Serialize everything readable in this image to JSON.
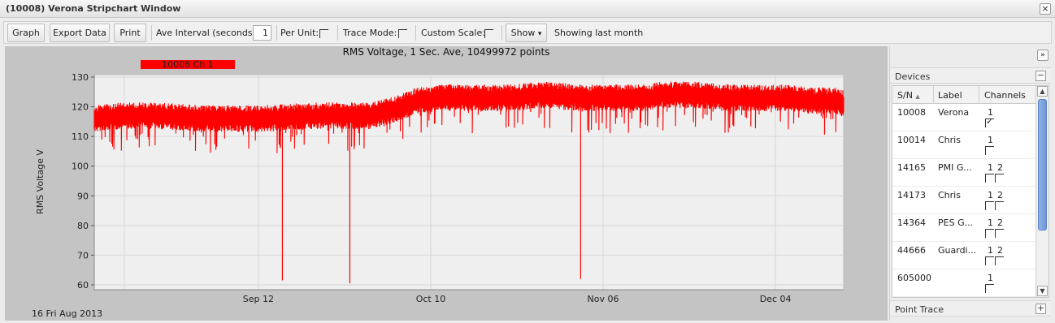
{
  "window": {
    "title": "(10008) Verona Stripchart Window",
    "close_glyph": "×"
  },
  "toolbar": {
    "graph": "Graph",
    "export": "Export Data",
    "print": "Print",
    "ave_label": "Ave Interval (seconds)",
    "ave_value": "1",
    "per_unit": "Per Unit:",
    "trace_mode": "Trace Mode:",
    "custom_scale": "Custom Scale:",
    "show": "Show",
    "show_arrow": "▾",
    "status": "Showing last month"
  },
  "chart": {
    "title": "RMS Voltage, 1 Sec. Ave, 10499972 points",
    "legend": "10008 Ch 1",
    "date_label": "16 Fri Aug 2013",
    "series_color": "#ff0000"
  },
  "chart_data": {
    "type": "line",
    "title": "RMS Voltage, 1 Sec. Ave, 10499972 points",
    "ylabel": "RMS Voltage V",
    "xlabel": "",
    "ylim": [
      60,
      130
    ],
    "yticks": [
      130,
      120,
      110,
      100,
      90,
      80,
      70,
      60
    ],
    "xticks": [
      "Sep 12",
      "Oct 10",
      "Nov 06",
      "Dec 04"
    ],
    "series": [
      {
        "name": "10008 Ch 1",
        "baseline": [
          [
            0.0,
            116
          ],
          [
            0.04,
            117
          ],
          [
            0.08,
            117
          ],
          [
            0.15,
            116
          ],
          [
            0.22,
            116
          ],
          [
            0.3,
            117
          ],
          [
            0.37,
            117
          ],
          [
            0.4,
            119
          ],
          [
            0.43,
            122
          ],
          [
            0.46,
            123
          ],
          [
            0.5,
            123
          ],
          [
            0.55,
            123
          ],
          [
            0.6,
            124
          ],
          [
            0.65,
            123
          ],
          [
            0.7,
            123
          ],
          [
            0.74,
            123
          ],
          [
            0.75,
            124
          ],
          [
            0.8,
            124
          ],
          [
            0.85,
            123
          ],
          [
            0.9,
            123
          ],
          [
            0.93,
            123
          ],
          [
            0.96,
            122
          ],
          [
            0.99,
            122
          ],
          [
            1.0,
            121
          ]
        ],
        "spikes": [
          {
            "x": 0.251,
            "y": 61.5
          },
          {
            "x": 0.341,
            "y": 60.5
          },
          {
            "x": 0.649,
            "y": 62
          }
        ]
      }
    ]
  },
  "devices": {
    "header": "Devices",
    "collapse_glyph": "−",
    "columns": [
      "S/N",
      "Label",
      "Channels"
    ],
    "sort_glyph": "▲",
    "rows": [
      {
        "sn": "10008",
        "label": "Verona",
        "channels": [
          "1"
        ],
        "checked": [
          true
        ]
      },
      {
        "sn": "10014",
        "label": "Chris",
        "channels": [
          "1"
        ],
        "checked": [
          false
        ]
      },
      {
        "sn": "14165",
        "label": "PMI G...",
        "channels": [
          "1",
          "2"
        ],
        "checked": [
          false,
          false
        ]
      },
      {
        "sn": "14173",
        "label": "Chris",
        "channels": [
          "1",
          "2"
        ],
        "checked": [
          false,
          false
        ]
      },
      {
        "sn": "14364",
        "label": "PES G...",
        "channels": [
          "1",
          "2"
        ],
        "checked": [
          false,
          false
        ]
      },
      {
        "sn": "44666",
        "label": "Guardi...",
        "channels": [
          "1",
          "2"
        ],
        "checked": [
          false,
          false
        ]
      },
      {
        "sn": "605000",
        "label": "",
        "channels": [
          "1"
        ],
        "checked": [
          false
        ]
      }
    ]
  },
  "point_trace": {
    "header": "Point Trace",
    "expand_glyph": "+"
  },
  "panel": {
    "expand_glyph": "»"
  }
}
